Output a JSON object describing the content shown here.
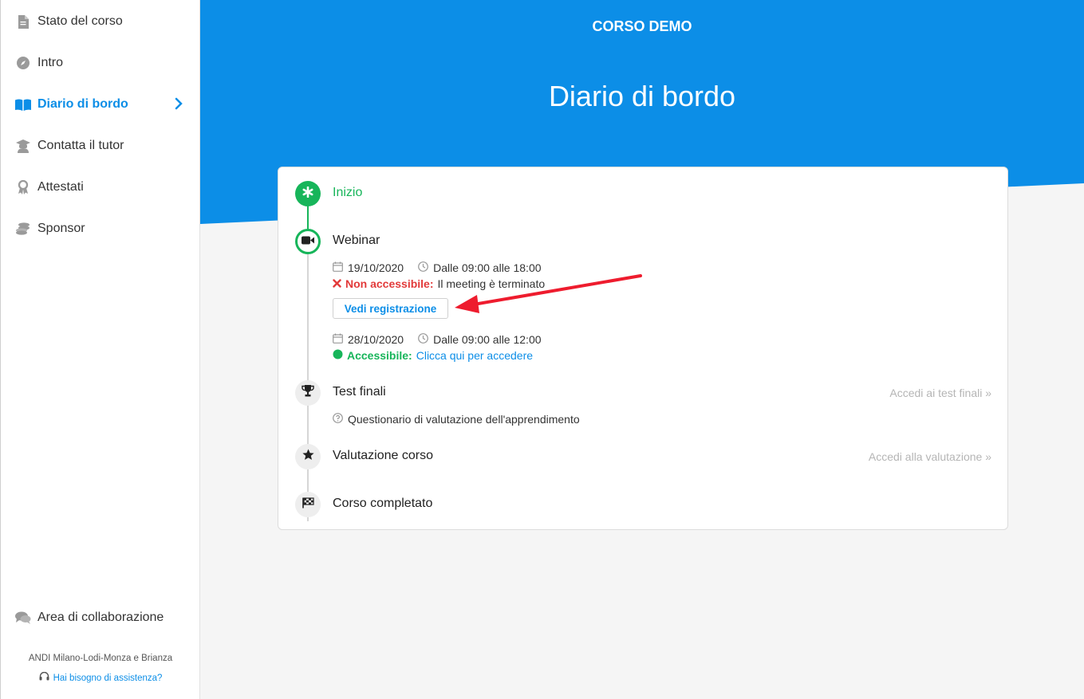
{
  "sidebar": {
    "items": [
      {
        "label": "Stato del corso",
        "icon": "document-icon"
      },
      {
        "label": "Intro",
        "icon": "compass-icon"
      },
      {
        "label": "Diario di bordo",
        "icon": "book-icon",
        "active": true
      },
      {
        "label": "Contatta il tutor",
        "icon": "graduate-icon"
      },
      {
        "label": "Attestati",
        "icon": "award-icon"
      },
      {
        "label": "Sponsor",
        "icon": "coins-icon"
      }
    ],
    "collab": {
      "label": "Area di collaborazione",
      "icon": "chat-icon"
    },
    "org": "ANDI Milano-Lodi-Monza e Brianza",
    "help": "Hai bisogno di assistenza?"
  },
  "header": {
    "course_name": "CORSO DEMO",
    "page_title": "Diario di bordo"
  },
  "timeline": {
    "start": {
      "title": "Inizio"
    },
    "webinar": {
      "title": "Webinar",
      "session1": {
        "date": "19/10/2020",
        "time": "Dalle 09:00 alle 18:00",
        "status": "Non accessibile:",
        "status_text": "Il meeting è terminato",
        "button": "Vedi registrazione"
      },
      "session2": {
        "date": "28/10/2020",
        "time": "Dalle 09:00 alle 12:00",
        "status": "Accessibile:",
        "status_text": "Clicca qui per accedere"
      }
    },
    "test": {
      "title": "Test finali",
      "link": "Accedi ai test finali »",
      "item": "Questionario di valutazione dell'apprendimento"
    },
    "rating": {
      "title": "Valutazione corso",
      "link": "Accedi alla valutazione »"
    },
    "complete": {
      "title": "Corso completato"
    }
  },
  "colors": {
    "accent": "#0c8ee7",
    "success": "#17b55a",
    "error": "#e23a3a",
    "arrow": "#ee1c2e"
  }
}
